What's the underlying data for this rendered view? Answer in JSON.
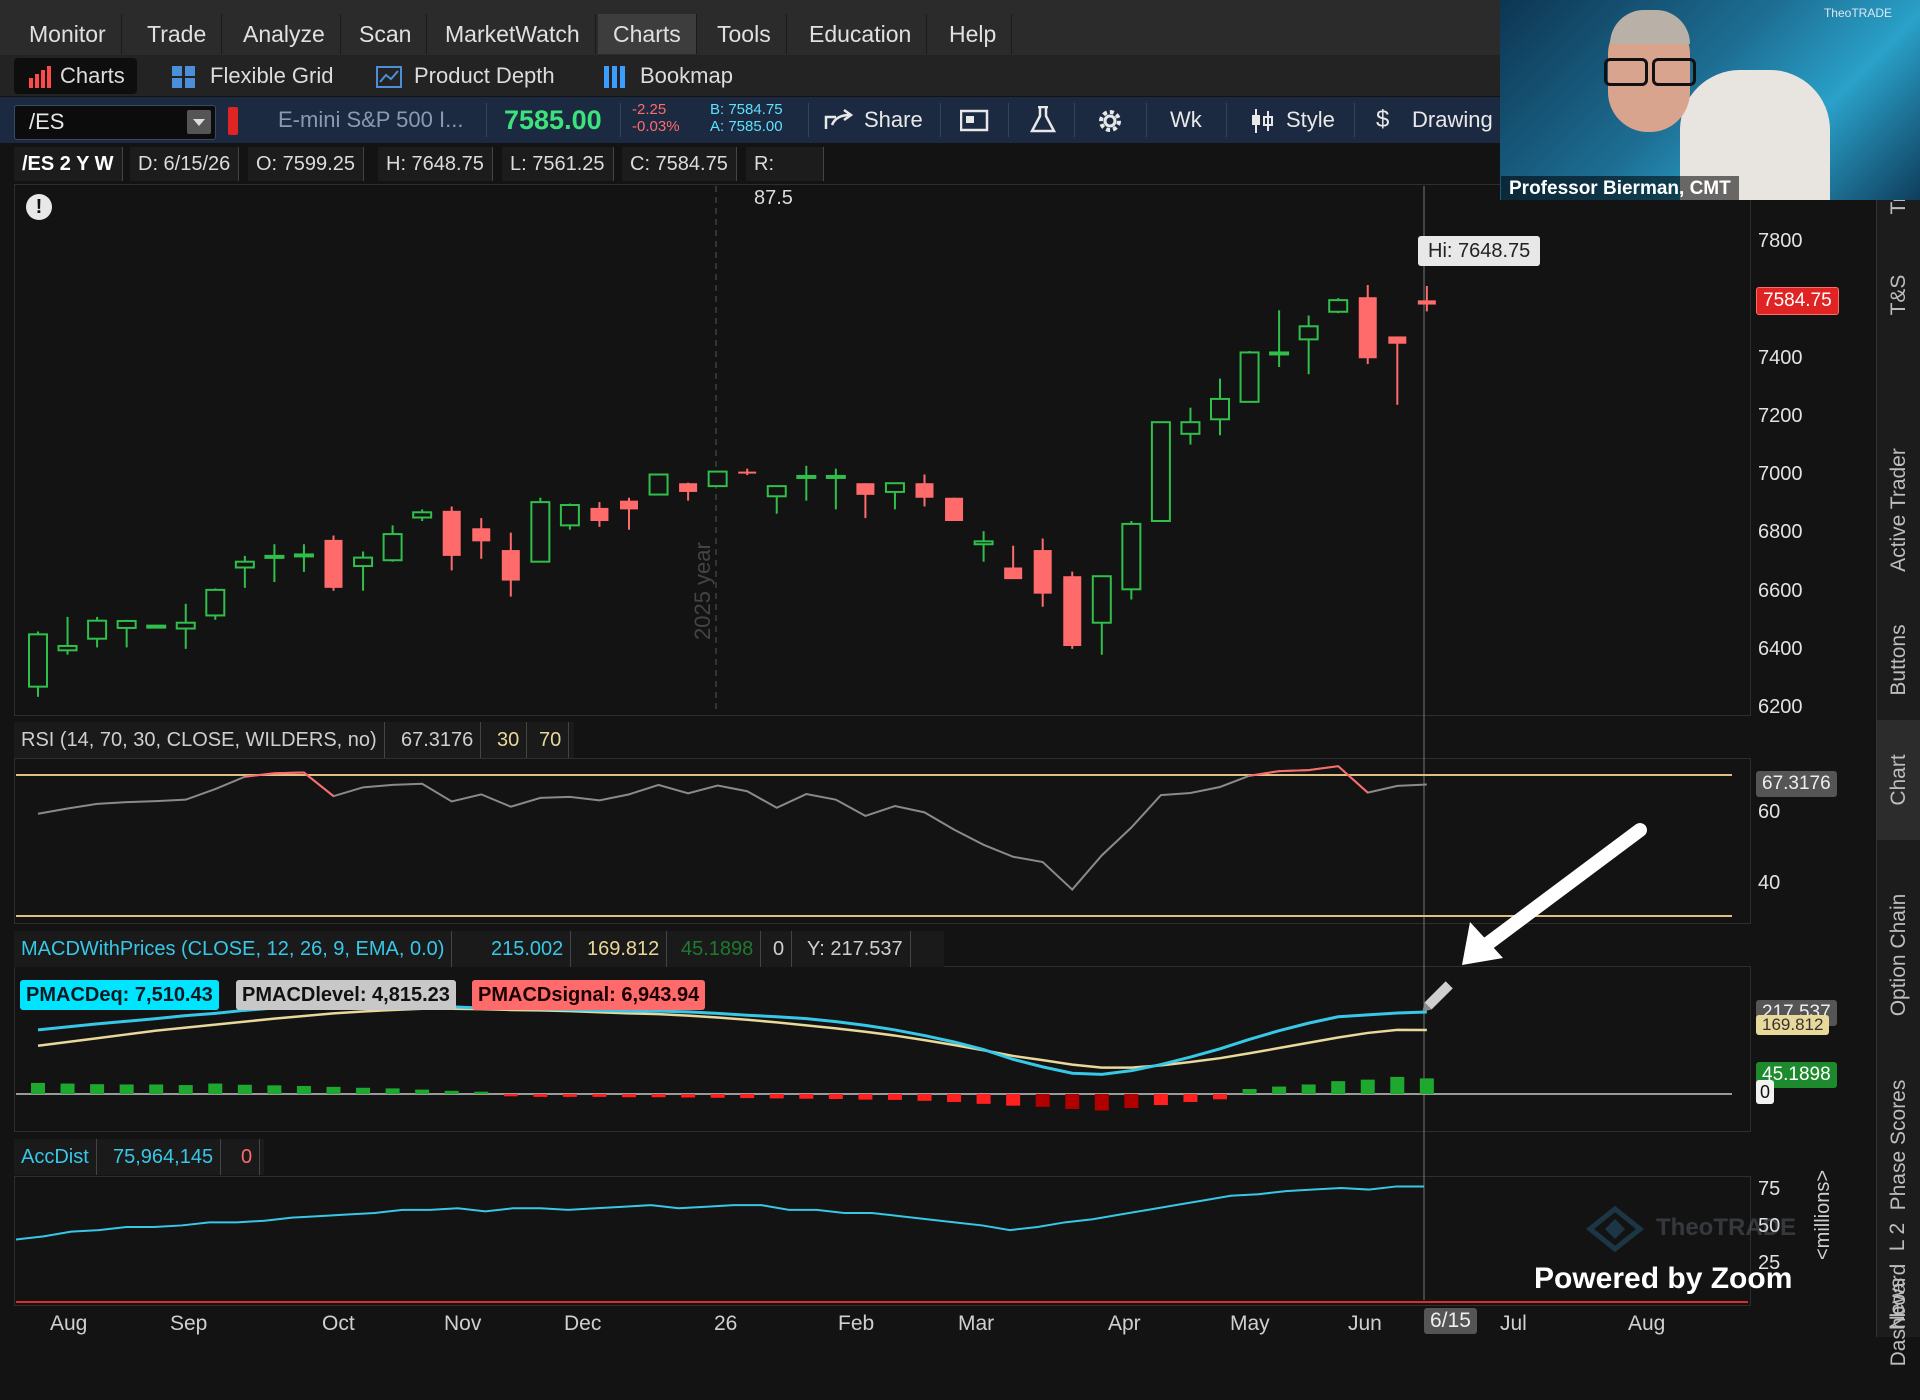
{
  "menu": {
    "items": [
      "Monitor",
      "Trade",
      "Analyze",
      "Scan",
      "MarketWatch",
      "Charts",
      "Tools",
      "Education",
      "Help"
    ],
    "active": "Charts"
  },
  "subtabs": [
    "Charts",
    "Flexible Grid",
    "Product Depth",
    "Bookmap"
  ],
  "toolbar": {
    "symbol": "/ES",
    "description": "E-mini S&P 500 I...",
    "last": "7585.00",
    "change": "-2.25",
    "change_pct": "-0.03%",
    "bid": "B: 7584.75",
    "ask": "A: 7585.00",
    "share_label": "Share",
    "period_label": "Wk",
    "style_label": "Style",
    "drawings_label": "Drawing"
  },
  "info": {
    "symbol_period": "/ES 2 Y W",
    "date": "D: 6/15/26",
    "open": "O: 7599.25",
    "high": "H: 7648.75",
    "low": "L: 7561.25",
    "close": "C: 7584.75",
    "range": "R: 87.5"
  },
  "price_pane": {
    "hi_label": "Hi: 7648.75",
    "last_price_tag": "7584.75",
    "year_marker": "2025 year",
    "alert_glyph": "!",
    "y_ticks": [
      "7800",
      "7400",
      "7200",
      "7000",
      "6800",
      "6600",
      "6400",
      "6200"
    ]
  },
  "rsi": {
    "label": "RSI (14, 70, 30, CLOSE, WILDERS, no)",
    "value": "67.3176",
    "oversold": "30",
    "overbought": "70",
    "y_ticks": [
      "60",
      "40"
    ]
  },
  "macd": {
    "label": "MACDWithPrices (CLOSE, 12, 26, 9, EMA, 0.0)",
    "value1": "215.002",
    "value2": "169.812",
    "value3": "45.1898",
    "value4": "0",
    "y_readout": "Y: 217.537",
    "peq": "PMACDeq: 7,510.43",
    "plevel": "PMACDlevel: 4,815.23",
    "psignal": "PMACDsignal: 6,943.94",
    "tag_value": "217.537",
    "tag_signal": "169.812",
    "tag_hist": "45.1898",
    "tag_zero": "0"
  },
  "accdist": {
    "label": "AccDist",
    "value": "75,964,145",
    "zero": "0",
    "y_ticks": [
      "75",
      "50",
      "25"
    ],
    "unit": "<millions>"
  },
  "x_axis": {
    "months": [
      "Aug",
      "Sep",
      "Oct",
      "Nov",
      "Dec",
      "26",
      "Feb",
      "Mar",
      "Apr",
      "May",
      "Jun",
      "6/15",
      "Jul",
      "Aug"
    ]
  },
  "side_tabs": [
    "Tr",
    "T&S",
    "Active Trader",
    "Buttons",
    "Chart",
    "Option Chain",
    "Phase Scores",
    "Dashboard",
    "L 2",
    "News"
  ],
  "webcam": {
    "name": "Professor Bierman, CMT",
    "logo": "TheoTRADE"
  },
  "watermark": "TheoTRADE",
  "zoom_label": "Powered by Zoom",
  "colors": {
    "up": "#2fbf4a",
    "down": "#ff6b6b",
    "macd": "#37c8e8",
    "signal": "#e8d89a",
    "accent": "#00e5ff"
  },
  "chart_data": {
    "type": "candlestick",
    "timeframe": "weekly",
    "candles": [
      {
        "o": 6270,
        "h": 6460,
        "l": 6235,
        "c": 6450
      },
      {
        "o": 6395,
        "h": 6510,
        "l": 6380,
        "c": 6410
      },
      {
        "o": 6435,
        "h": 6510,
        "l": 6405,
        "c": 6497
      },
      {
        "o": 6472,
        "h": 6500,
        "l": 6405,
        "c": 6496
      },
      {
        "o": 6476,
        "h": 6480,
        "l": 6485,
        "c": 6480
      },
      {
        "o": 6470,
        "h": 6555,
        "l": 6400,
        "c": 6490
      },
      {
        "o": 6515,
        "h": 6608,
        "l": 6500,
        "c": 6603
      },
      {
        "o": 6680,
        "h": 6720,
        "l": 6610,
        "c": 6700
      },
      {
        "o": 6715,
        "h": 6760,
        "l": 6630,
        "c": 6720
      },
      {
        "o": 6720,
        "h": 6760,
        "l": 6665,
        "c": 6725
      },
      {
        "o": 6775,
        "h": 6790,
        "l": 6600,
        "c": 6610
      },
      {
        "o": 6685,
        "h": 6735,
        "l": 6600,
        "c": 6714
      },
      {
        "o": 6705,
        "h": 6825,
        "l": 6700,
        "c": 6795
      },
      {
        "o": 6852,
        "h": 6880,
        "l": 6840,
        "c": 6870
      },
      {
        "o": 6875,
        "h": 6890,
        "l": 6670,
        "c": 6720
      },
      {
        "o": 6815,
        "h": 6850,
        "l": 6710,
        "c": 6770
      },
      {
        "o": 6740,
        "h": 6800,
        "l": 6580,
        "c": 6635
      },
      {
        "o": 6700,
        "h": 6920,
        "l": 6700,
        "c": 6905
      },
      {
        "o": 6825,
        "h": 6900,
        "l": 6810,
        "c": 6895
      },
      {
        "o": 6885,
        "h": 6905,
        "l": 6820,
        "c": 6840
      },
      {
        "o": 6910,
        "h": 6920,
        "l": 6810,
        "c": 6880
      },
      {
        "o": 6931,
        "h": 7003,
        "l": 6934,
        "c": 7000
      },
      {
        "o": 6970,
        "h": 6972,
        "l": 6910,
        "c": 6940
      },
      {
        "o": 6960,
        "h": 7008,
        "l": 6965,
        "c": 7010
      },
      {
        "o": 7010,
        "h": 7020,
        "l": 6998,
        "c": 7005
      },
      {
        "o": 6925,
        "h": 6962,
        "l": 6865,
        "c": 6960
      },
      {
        "o": 6995,
        "h": 7030,
        "l": 6910,
        "c": 6995
      },
      {
        "o": 6995,
        "h": 7020,
        "l": 6880,
        "c": 6995
      },
      {
        "o": 6970,
        "h": 6967,
        "l": 6850,
        "c": 6930
      },
      {
        "o": 6940,
        "h": 6968,
        "l": 6880,
        "c": 6970
      },
      {
        "o": 6970,
        "h": 7000,
        "l": 6890,
        "c": 6920
      },
      {
        "o": 6920,
        "h": 6920,
        "l": 6840,
        "c": 6840
      },
      {
        "o": 6760,
        "h": 6805,
        "l": 6700,
        "c": 6770
      },
      {
        "o": 6680,
        "h": 6755,
        "l": 6640,
        "c": 6640
      },
      {
        "o": 6740,
        "h": 6780,
        "l": 6545,
        "c": 6590
      },
      {
        "o": 6650,
        "h": 6666,
        "l": 6400,
        "c": 6410
      },
      {
        "o": 6490,
        "h": 6650,
        "l": 6380,
        "c": 6650
      },
      {
        "o": 6605,
        "h": 6840,
        "l": 6570,
        "c": 6830
      },
      {
        "o": 6840,
        "h": 7183,
        "l": 6842,
        "c": 7180
      },
      {
        "o": 7140,
        "h": 7230,
        "l": 7103,
        "c": 7180
      },
      {
        "o": 7190,
        "h": 7330,
        "l": 7135,
        "c": 7260
      },
      {
        "o": 7250,
        "h": 7425,
        "l": 7260,
        "c": 7420
      },
      {
        "o": 7420,
        "h": 7565,
        "l": 7370,
        "c": 7420
      },
      {
        "o": 7465,
        "h": 7547,
        "l": 7345,
        "c": 7510
      },
      {
        "o": 7560,
        "h": 7607,
        "l": 7555,
        "c": 7600
      },
      {
        "o": 7610,
        "h": 7652,
        "l": 7380,
        "c": 7400
      },
      {
        "o": 7475,
        "h": 7468,
        "l": 7240,
        "c": 7450
      },
      {
        "o": 7599.25,
        "h": 7648.75,
        "l": 7561.25,
        "c": 7584.75
      }
    ],
    "ylim": [
      6200,
      7850
    ],
    "rsi_ylim": [
      30,
      75
    ],
    "rsi": [
      59,
      60.5,
      61.8,
      62.3,
      62.6,
      63,
      66,
      69.5,
      70.5,
      70.7,
      64,
      66.5,
      67.2,
      67.5,
      62.5,
      64.5,
      61,
      63.5,
      63.8,
      62.8,
      64.5,
      67.2,
      64.8,
      67,
      65.4,
      60.7,
      64.6,
      63,
      58.4,
      61.2,
      59.4,
      54.5,
      50.2,
      46.8,
      45.3,
      37.5,
      47.2,
      55.1,
      64.3,
      64.9,
      66.6,
      69.8,
      71.1,
      71.4,
      72.5,
      65,
      66.9,
      67.3176
    ],
    "macd_ylim": [
      -100,
      300
    ],
    "macd": [
      170,
      178,
      186,
      193,
      200,
      208,
      214,
      222,
      228,
      232,
      236,
      235,
      238,
      235,
      231,
      228,
      227,
      226,
      224,
      222,
      220,
      220,
      218,
      214,
      209,
      205,
      200,
      192,
      182,
      170,
      155,
      138,
      118,
      92,
      72,
      55,
      52,
      62,
      78,
      98,
      120,
      145,
      168,
      188,
      205,
      210,
      215,
      217.537
    ],
    "signal": [
      128,
      138,
      148,
      158,
      168,
      176,
      184,
      192,
      200,
      207,
      214,
      219,
      223,
      226,
      226,
      225,
      223,
      222,
      220,
      217,
      214,
      212,
      208,
      203,
      197,
      190,
      182,
      174,
      165,
      155,
      143,
      130,
      116,
      101,
      90,
      78,
      70,
      70,
      76,
      85,
      95,
      108,
      122,
      136,
      150,
      162,
      170,
      169.812
    ],
    "hist": [
      30,
      28,
      26,
      25,
      25,
      23,
      28,
      24,
      22,
      20,
      17,
      14,
      12,
      8,
      4,
      1,
      -1,
      -3,
      -3,
      -3,
      -4,
      -4,
      -5,
      -6,
      -7,
      -8,
      -9,
      -10,
      -12,
      -13,
      -16,
      -20,
      -26,
      -32,
      -36,
      -43,
      -48,
      -40,
      -30,
      -20,
      -11,
      10,
      18,
      25,
      36,
      41,
      50,
      45.1898
    ],
    "accdist_ylim": [
      0,
      80
    ],
    "accdist": [
      42,
      44,
      47,
      48,
      50,
      50,
      51,
      53,
      53,
      54,
      56,
      57,
      58,
      59,
      61,
      61,
      62,
      60,
      62,
      62,
      61,
      62,
      63,
      64,
      62,
      63,
      64,
      64,
      61,
      61,
      59,
      59,
      57,
      55,
      53,
      51,
      48,
      50,
      53,
      55,
      58,
      61,
      64,
      67,
      70,
      71,
      73,
      74,
      75,
      74,
      76,
      76
    ]
  }
}
